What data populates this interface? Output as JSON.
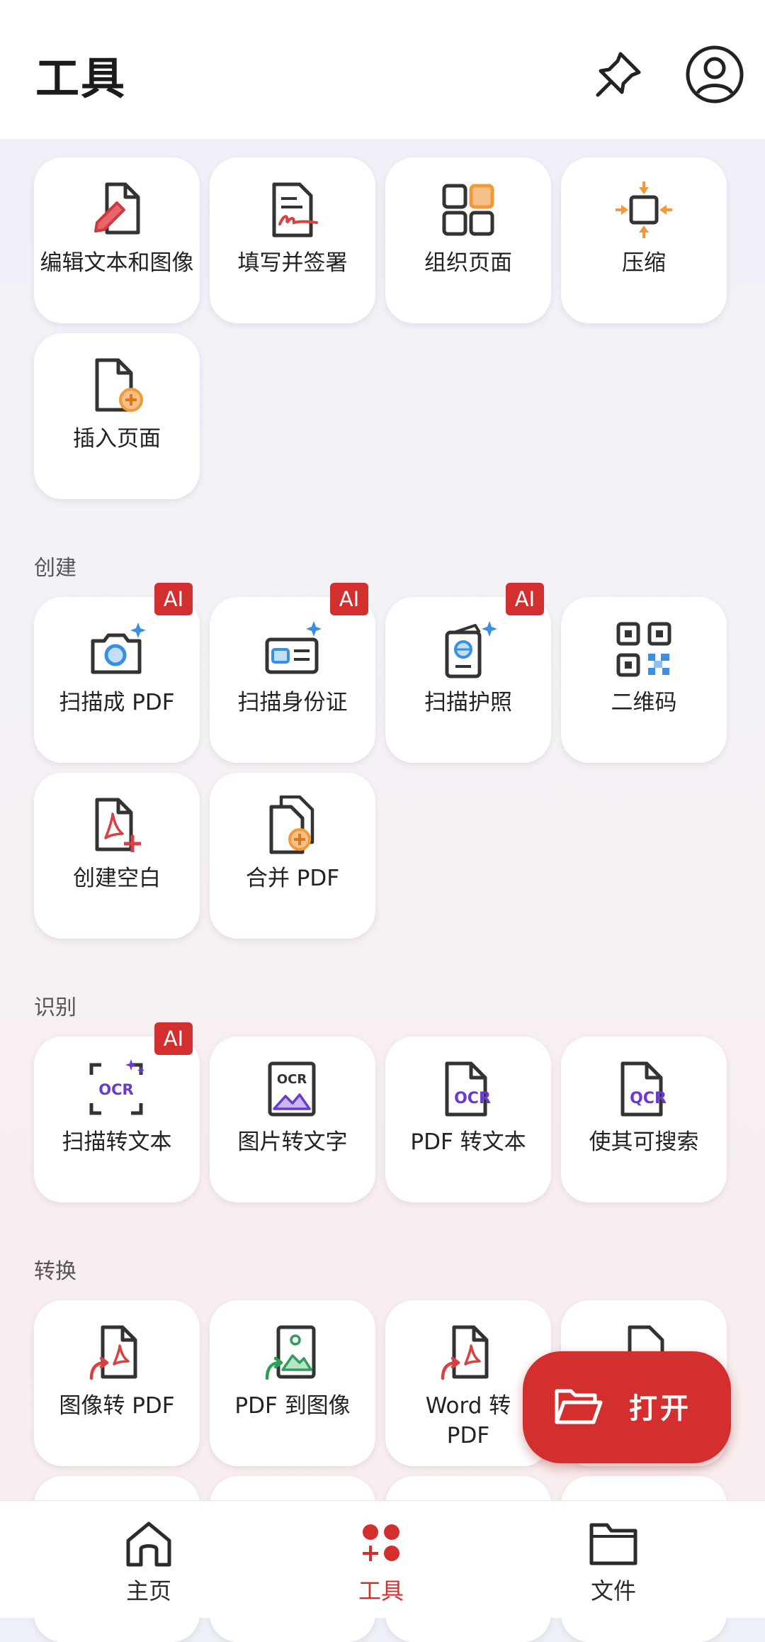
{
  "header": {
    "title": "工具"
  },
  "tools_top": [
    {
      "label": "编辑文本和图像",
      "icon": "edit-text-image-icon"
    },
    {
      "label": "填写并签署",
      "icon": "fill-sign-icon"
    },
    {
      "label": "组织页面",
      "icon": "organize-pages-icon"
    },
    {
      "label": "压缩",
      "icon": "compress-icon"
    },
    {
      "label": "插入页面",
      "icon": "insert-page-icon"
    }
  ],
  "sections": {
    "create": {
      "title": "创建",
      "items": [
        {
          "label": "扫描成 PDF",
          "badge": "AI",
          "icon": "scan-camera-icon"
        },
        {
          "label": "扫描身份证",
          "badge": "AI",
          "icon": "scan-id-card-icon"
        },
        {
          "label": "扫描护照",
          "badge": "AI",
          "icon": "scan-passport-icon"
        },
        {
          "label": "二维码",
          "icon": "qr-code-icon"
        },
        {
          "label": "创建空白",
          "icon": "create-blank-icon"
        },
        {
          "label": "合并 PDF",
          "icon": "merge-pdf-icon"
        }
      ]
    },
    "recognize": {
      "title": "识别",
      "items": [
        {
          "label": "扫描转文本",
          "badge": "AI",
          "icon": "scan-ocr-icon"
        },
        {
          "label": "图片转文字",
          "icon": "image-ocr-icon"
        },
        {
          "label": "PDF 转文本",
          "icon": "pdf-ocr-icon"
        },
        {
          "label": "使其可搜索",
          "icon": "searchable-ocr-icon"
        }
      ],
      "icon_texts": {
        "ocr": "OCR",
        "qcr": "QCR"
      }
    },
    "convert": {
      "title": "转换",
      "items": [
        {
          "label": "图像转 PDF",
          "icon": "image-to-pdf-icon"
        },
        {
          "label": "PDF 到图像",
          "icon": "pdf-to-image-icon"
        },
        {
          "label": "Word 转 PDF",
          "icon": "word-to-pdf-icon"
        }
      ]
    }
  },
  "fab": {
    "label": "打开",
    "icon": "folder-open-icon"
  },
  "bottom_nav": [
    {
      "label": "主页",
      "icon": "home-icon",
      "active": false
    },
    {
      "label": "工具",
      "icon": "tools-icon",
      "active": true
    },
    {
      "label": "文件",
      "icon": "folder-icon",
      "active": false
    }
  ],
  "colors": {
    "accent": "#d32f2f",
    "orange": "#f29a3a",
    "blue": "#3b8fe0",
    "purple": "#6a38d6",
    "green": "#2e9e5a"
  }
}
